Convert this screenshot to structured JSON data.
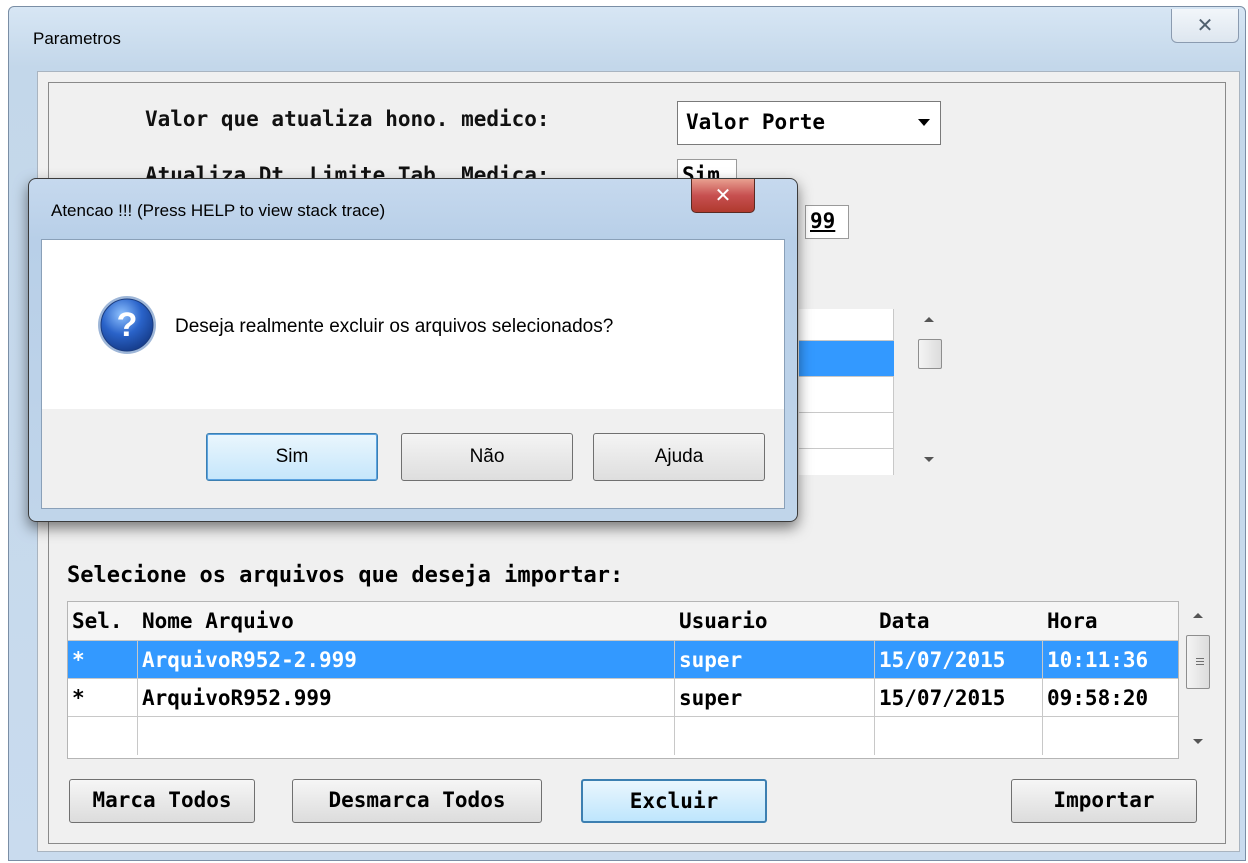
{
  "main_window": {
    "title": "Parametros",
    "close_glyph": "✕"
  },
  "form": {
    "hono_label": "Valor que atualiza hono. medico:",
    "hono_value": "Valor Porte",
    "atualiza_label": "Atualiza Dt. Limite Tab. Medica:",
    "atualiza_value": "Sim",
    "partial_value": "99"
  },
  "import_section": {
    "label": "Selecione os arquivos que deseja importar:",
    "columns": [
      "Sel.",
      "Nome Arquivo",
      "Usuario",
      "Data",
      "Hora"
    ],
    "rows": [
      {
        "sel": "*",
        "nome": "ArquivoR952-2.999",
        "usuario": "super",
        "data": "15/07/2015",
        "hora": "10:11:36",
        "selected": true
      },
      {
        "sel": "*",
        "nome": "ArquivoR952.999",
        "usuario": "super",
        "data": "15/07/2015",
        "hora": "09:58:20",
        "selected": false
      }
    ]
  },
  "buttons": {
    "marca_todos": "Marca Todos",
    "desmarca_todos": "Desmarca Todos",
    "excluir": "Excluir",
    "importar": "Importar"
  },
  "dialog": {
    "title": "Atencao !!!  (Press HELP to view stack trace)",
    "close_glyph": "✕",
    "icon": "question-icon",
    "message": "Deseja realmente excluir os arquivos selecionados?",
    "sim": "Sim",
    "nao": "Não",
    "ajuda": "Ajuda"
  },
  "colors": {
    "selection": "#3399ff",
    "focus_border": "#3c7fb1"
  }
}
